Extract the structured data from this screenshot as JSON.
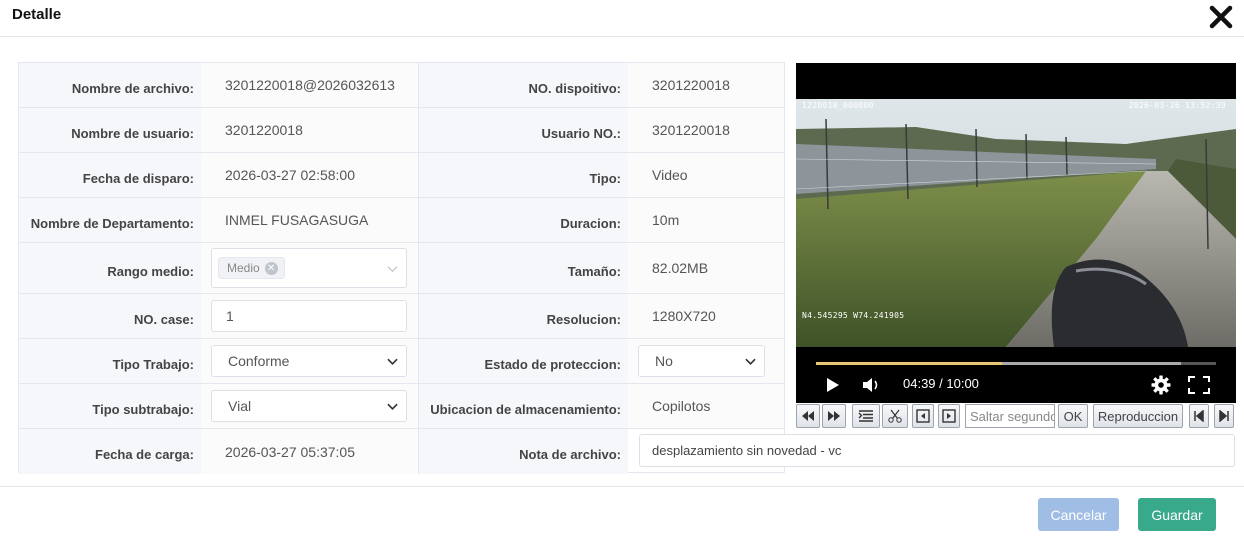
{
  "dialog": {
    "title": "Detalle"
  },
  "fields": {
    "nombre_archivo": {
      "label": "Nombre de archivo:",
      "value": "3201220018@2026032613"
    },
    "no_dispositivo": {
      "label": "NO. dispoitivo:",
      "value": "3201220018"
    },
    "nombre_usuario": {
      "label": "Nombre de usuario:",
      "value": "3201220018"
    },
    "usuario_no": {
      "label": "Usuario NO.:",
      "value": "3201220018"
    },
    "fecha_disparo": {
      "label": "Fecha de disparo:",
      "value": "2026-03-27 02:58:00"
    },
    "tipo": {
      "label": "Tipo:",
      "value": "Video"
    },
    "departamento": {
      "label": "Nombre de Departamento:",
      "value": "INMEL FUSAGASUGA"
    },
    "duracion": {
      "label": "Duracion:",
      "value": "10m"
    },
    "rango_medio": {
      "label": "Rango medio:",
      "tag": "Medio"
    },
    "tamano": {
      "label": "Tamaño:",
      "value": "82.02MB"
    },
    "no_case": {
      "label": "NO. case:",
      "value": "1"
    },
    "resolucion": {
      "label": "Resolucion:",
      "value": "1280X720"
    },
    "tipo_trabajo": {
      "label": "Tipo Trabajo:",
      "value": "Conforme"
    },
    "estado_proteccion": {
      "label": "Estado de proteccion:",
      "value": "No"
    },
    "tipo_subtrabajo": {
      "label": "Tipo subtrabajo:",
      "value": "Vial"
    },
    "ubicacion": {
      "label": "Ubicacion de almacenamiento:",
      "value": "Copilotos"
    },
    "fecha_carga": {
      "label": "Fecha de carga:",
      "value": "2026-03-27 05:37:05"
    },
    "nota": {
      "label": "Nota de archivo:",
      "value": "desplazamiento sin novedad - vc"
    }
  },
  "video": {
    "osd_top_left": "1220018_000000",
    "osd_top_right": "2026-03-26 13:52:39",
    "osd_gps": "N4.545295 W74.241905",
    "time": "04:39 / 10:00",
    "progress_fraction": 0.465,
    "buffered_fraction": 0.912
  },
  "toolbar": {
    "seek_placeholder": "Saltar segundo",
    "ok_label": "OK",
    "playback_label": "Reproduccion"
  },
  "footer": {
    "cancel_label": "Cancelar",
    "save_label": "Guardar"
  },
  "icons": [
    "close-icon",
    "play-icon",
    "volume-icon",
    "settings-icon",
    "fullscreen-icon",
    "rewind-icon",
    "fast-forward-icon",
    "list-icon",
    "scissors-icon",
    "prev-frame-icon",
    "next-frame-icon",
    "skip-start-icon",
    "skip-end-icon",
    "chevron-down-icon",
    "tag-close-icon"
  ],
  "colors": {
    "save": "#38a98b",
    "cancel": "#a0bde6",
    "progress": "#e8c675"
  }
}
